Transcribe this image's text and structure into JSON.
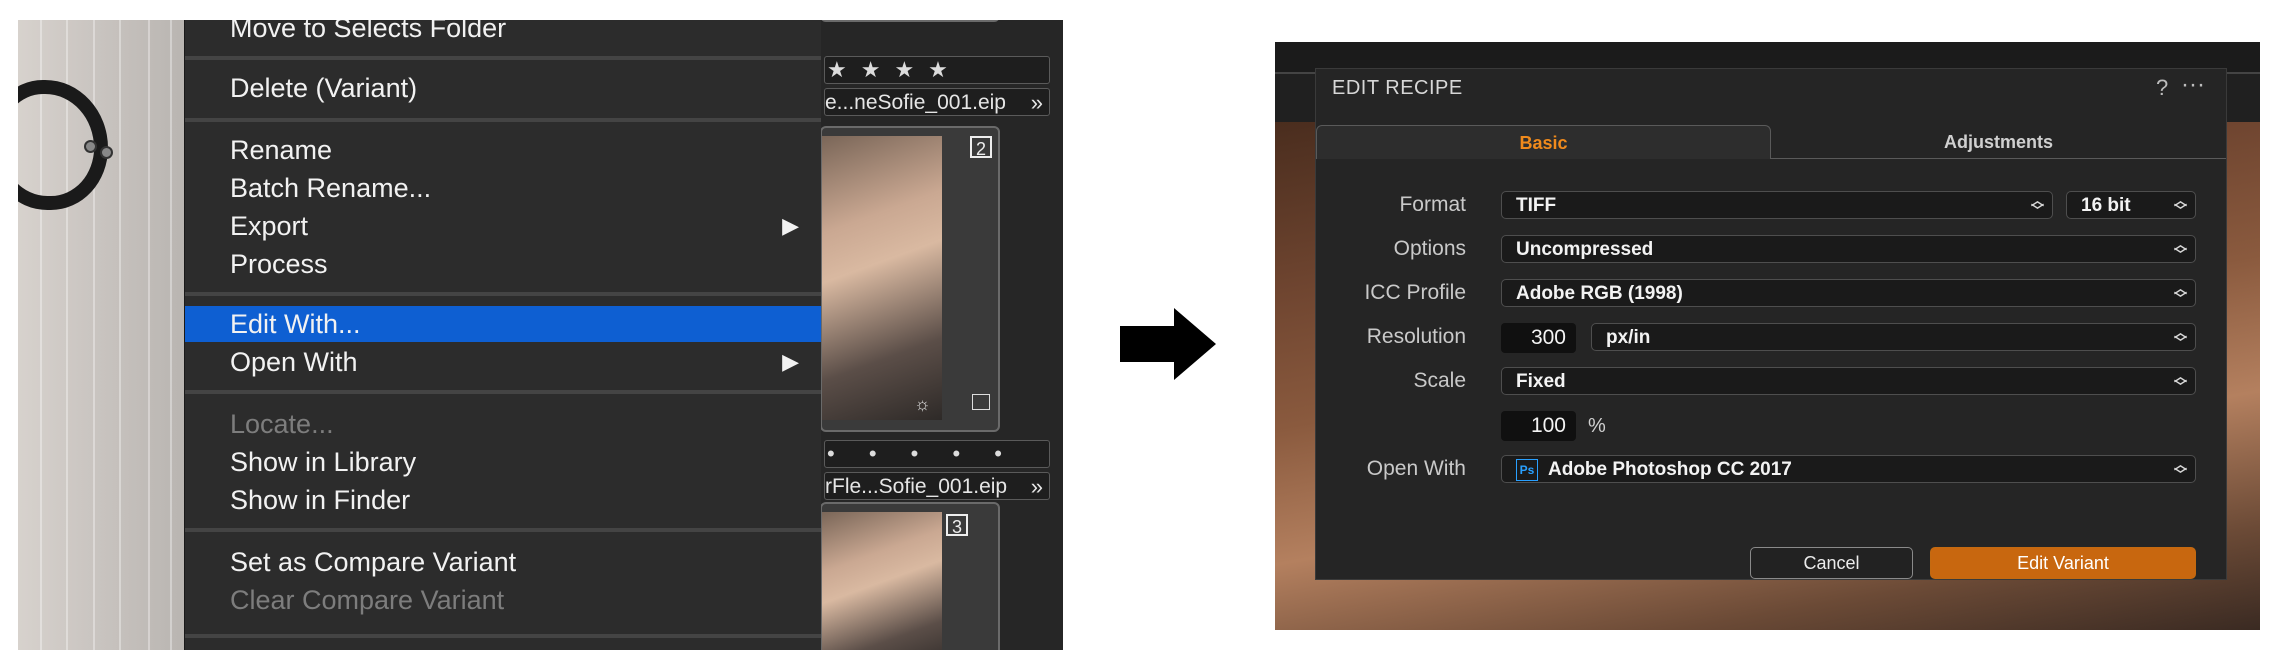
{
  "left": {
    "menu": {
      "items": [
        {
          "label": "Move to Selects Folder"
        },
        {
          "label": "Delete (Variant)"
        },
        {
          "label": "Rename"
        },
        {
          "label": "Batch Rename..."
        },
        {
          "label": "Export",
          "submenu": "▶"
        },
        {
          "label": "Process"
        },
        {
          "label": "Edit With..."
        },
        {
          "label": "Open With",
          "submenu": "▶"
        },
        {
          "label": "Locate..."
        },
        {
          "label": "Show in Library"
        },
        {
          "label": "Show in Finder"
        },
        {
          "label": "Set as Compare Variant"
        },
        {
          "label": "Clear Compare Variant"
        }
      ]
    },
    "browser": {
      "rating_row_1": "★★★★",
      "filename_1": "e...neSofie_001.eip",
      "badge_2": "2",
      "rating_row_2": "• • • • •",
      "filename_2": "rFle...Sofie_001.eip",
      "badge_3": "3",
      "chevron": "»"
    }
  },
  "dialog": {
    "title": "EDIT RECIPE",
    "help": "?",
    "more": "···",
    "tabs": [
      {
        "label": "Basic",
        "active": true
      },
      {
        "label": "Adjustments",
        "active": false
      }
    ],
    "fields": {
      "format": {
        "label": "Format",
        "value": "TIFF",
        "bit_depth": "16 bit"
      },
      "options": {
        "label": "Options",
        "value": "Uncompressed"
      },
      "icc_profile": {
        "label": "ICC Profile",
        "value": "Adobe RGB (1998)"
      },
      "resolution": {
        "label": "Resolution",
        "value": "300",
        "unit": "px/in"
      },
      "scale": {
        "label": "Scale",
        "value": "Fixed",
        "amount": "100",
        "unit": "%"
      },
      "open_with": {
        "label": "Open With",
        "app_icon": "Ps",
        "value": "Adobe Photoshop CC 2017"
      }
    },
    "buttons": {
      "cancel": "Cancel",
      "edit_variant": "Edit Variant"
    }
  },
  "colors": {
    "menu_highlight": "#0e5fd2",
    "accent_orange": "#f08a1c",
    "edit_button": "#c8670f"
  }
}
